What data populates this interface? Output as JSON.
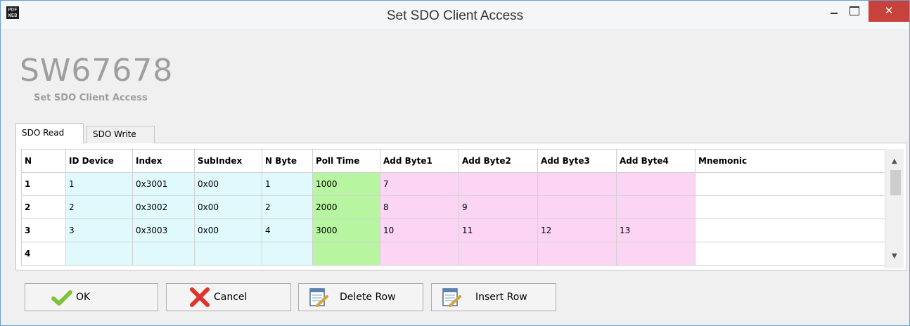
{
  "window": {
    "title": "Set SDO Client Access",
    "app_icon_text": "PDF\nWEB",
    "close_glyph": "✕"
  },
  "header": {
    "product_code": "SW67678",
    "subtitle": "Set SDO Client Access"
  },
  "tabs": [
    {
      "label": "SDO Read",
      "active": true
    },
    {
      "label": "SDO Write",
      "active": false
    }
  ],
  "table": {
    "columns": [
      "N",
      "ID Device",
      "Index",
      "SubIndex",
      "N Byte",
      "Poll Time",
      "Add Byte1",
      "Add Byte2",
      "Add Byte3",
      "Add Byte4",
      "Mnemonic"
    ],
    "rows": [
      {
        "n": "1",
        "id_device": "1",
        "index": "0x3001",
        "subindex": "0x00",
        "n_byte": "1",
        "poll_time": "1000",
        "add_byte1": "7",
        "add_byte2": "",
        "add_byte3": "",
        "add_byte4": "",
        "mnemonic": ""
      },
      {
        "n": "2",
        "id_device": "2",
        "index": "0x3002",
        "subindex": "0x00",
        "n_byte": "2",
        "poll_time": "2000",
        "add_byte1": "8",
        "add_byte2": "9",
        "add_byte3": "",
        "add_byte4": "",
        "mnemonic": ""
      },
      {
        "n": "3",
        "id_device": "3",
        "index": "0x3003",
        "subindex": "0x00",
        "n_byte": "4",
        "poll_time": "3000",
        "add_byte1": "10",
        "add_byte2": "11",
        "add_byte3": "12",
        "add_byte4": "13",
        "mnemonic": ""
      },
      {
        "n": "4",
        "id_device": "",
        "index": "",
        "subindex": "",
        "n_byte": "",
        "poll_time": "",
        "add_byte1": "",
        "add_byte2": "",
        "add_byte3": "",
        "add_byte4": "",
        "mnemonic": ""
      }
    ]
  },
  "buttons": {
    "ok": "OK",
    "cancel": "Cancel",
    "delete_row": "Delete Row",
    "insert_row": "Insert Row"
  },
  "colors": {
    "id_group": "#e0f9fd",
    "poll_time": "#b7f5a0",
    "add_bytes": "#fbd5f3",
    "close_button": "#c7423a"
  }
}
